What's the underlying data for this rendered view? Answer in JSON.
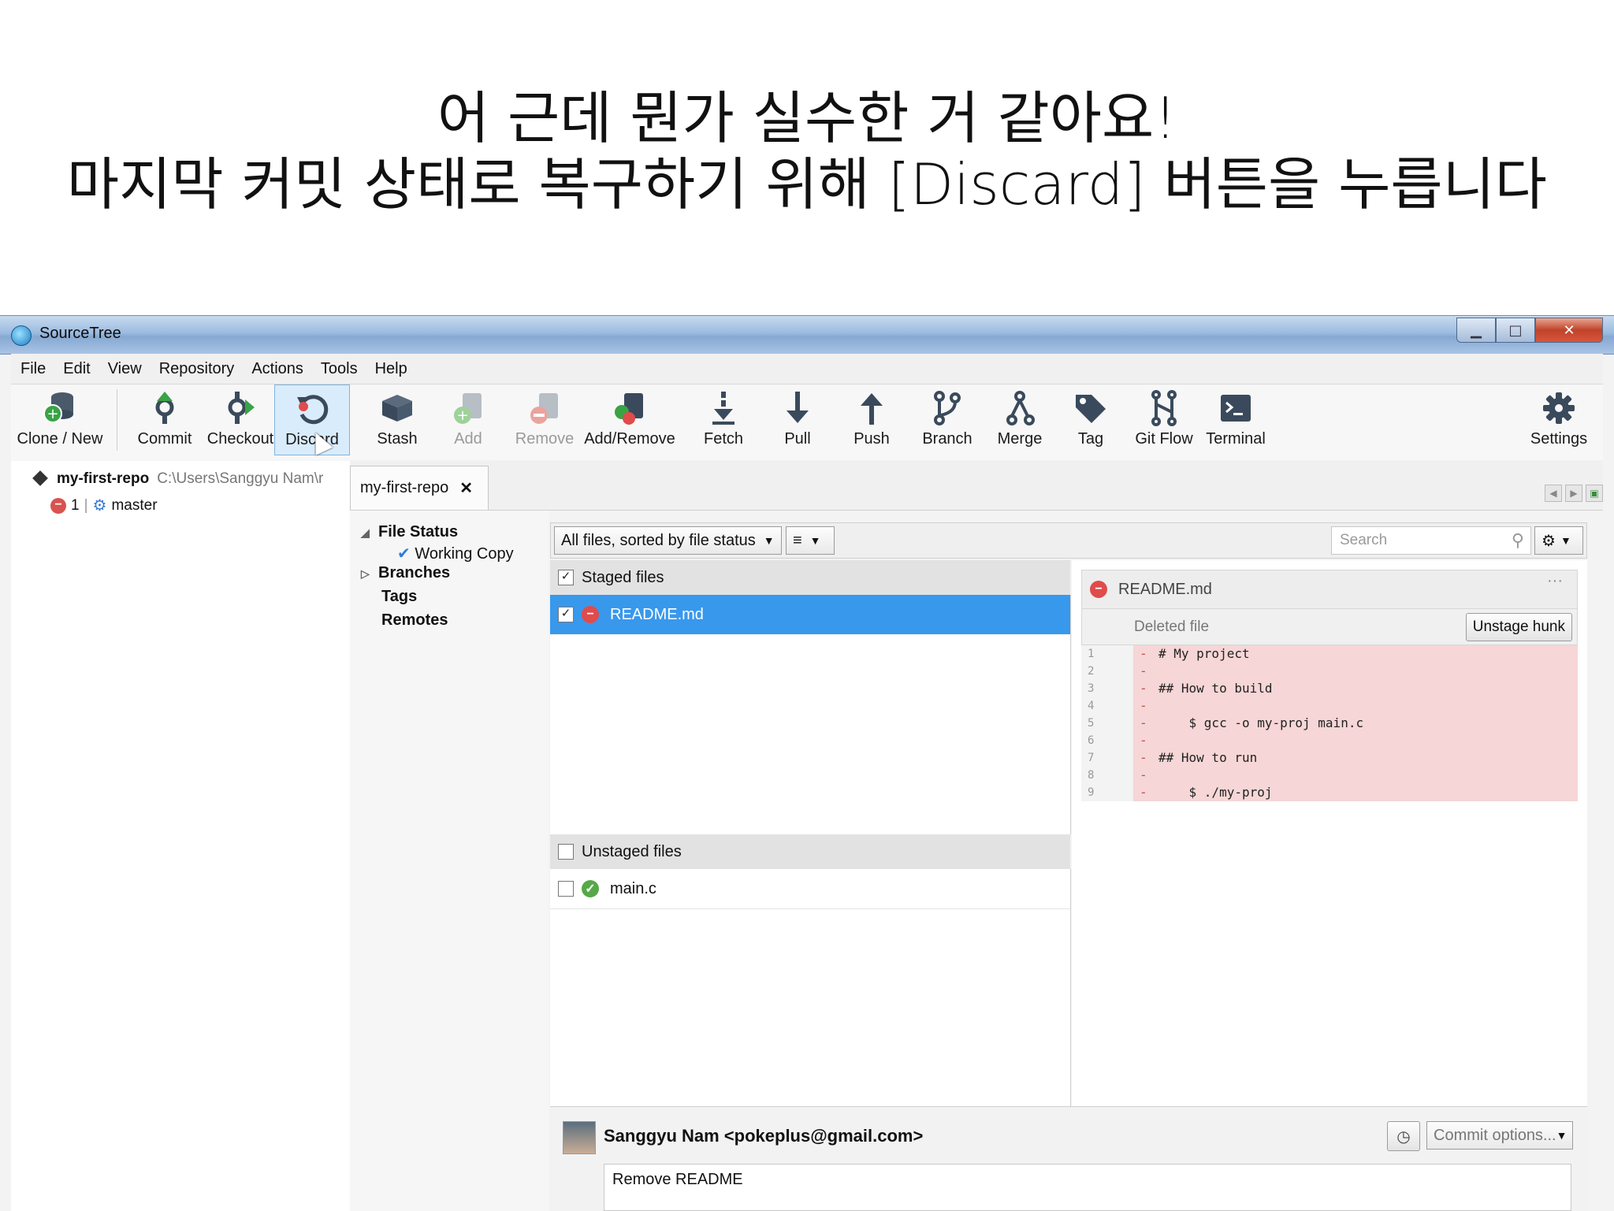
{
  "caption": {
    "line1": "어 근데 뭔가 실수한 거 같아요!",
    "line2": "마지막 커밋 상태로 복구하기 위해 [Discard] 버튼을 누릅니다"
  },
  "window": {
    "title": "SourceTree"
  },
  "menu": [
    "File",
    "Edit",
    "View",
    "Repository",
    "Actions",
    "Tools",
    "Help"
  ],
  "toolbar": {
    "clone_new": "Clone / New",
    "commit": "Commit",
    "checkout": "Checkout",
    "discard": "Discard",
    "stash": "Stash",
    "add": "Add",
    "remove": "Remove",
    "add_remove": "Add/Remove",
    "fetch": "Fetch",
    "pull": "Pull",
    "push": "Push",
    "branch": "Branch",
    "merge": "Merge",
    "tag": "Tag",
    "git_flow": "Git Flow",
    "terminal": "Terminal",
    "settings": "Settings"
  },
  "sidebar": {
    "repo_name": "my-first-repo",
    "repo_path": "C:\\Users\\Sanggyu Nam\\r",
    "pending_count": "1",
    "branch": "master"
  },
  "tab": {
    "label": "my-first-repo",
    "close": "✕"
  },
  "nav": {
    "file_status": "File Status",
    "working_copy": "Working Copy",
    "branches": "Branches",
    "tags": "Tags",
    "remotes": "Remotes"
  },
  "filter": {
    "sort_label": "All files, sorted by file status",
    "search_placeholder": "Search"
  },
  "staged": {
    "header": "Staged files",
    "files": [
      "README.md"
    ]
  },
  "unstaged": {
    "header": "Unstaged files",
    "files": [
      "main.c"
    ]
  },
  "diff": {
    "file_name": "README.md",
    "hunk_label": "Deleted file",
    "unstage_button": "Unstage hunk",
    "lines": [
      {
        "num": "1",
        "text": "# My project"
      },
      {
        "num": "2",
        "text": ""
      },
      {
        "num": "3",
        "text": "## How to build"
      },
      {
        "num": "4",
        "text": ""
      },
      {
        "num": "5",
        "text": "    $ gcc -o my-proj main.c"
      },
      {
        "num": "6",
        "text": ""
      },
      {
        "num": "7",
        "text": "## How to run"
      },
      {
        "num": "8",
        "text": ""
      },
      {
        "num": "9",
        "text": "    $ ./my-proj"
      }
    ]
  },
  "commit": {
    "author": "Sanggyu Nam <pokeplus@gmail.com>",
    "options_label": "Commit options...",
    "message": "Remove README"
  },
  "colors": {
    "selection": "#3898ec",
    "deleted_line_bg": "#f6d6d6",
    "titlebar": "#9cbbe0"
  }
}
